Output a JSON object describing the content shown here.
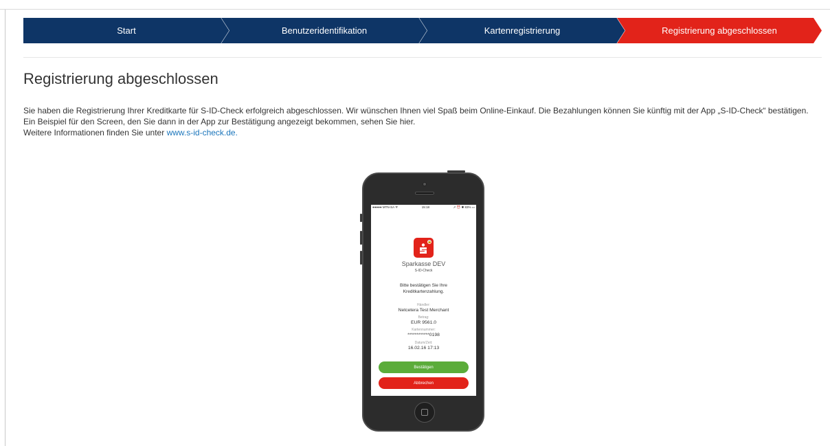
{
  "steps": [
    {
      "label": "Start",
      "state": "done"
    },
    {
      "label": "Benutzeridentifikation",
      "state": "done"
    },
    {
      "label": "Kartenregistrierung",
      "state": "done"
    },
    {
      "label": "Registrierung abgeschlossen",
      "state": "active"
    }
  ],
  "colors": {
    "step_done": "#0e3566",
    "step_active": "#e2231a",
    "link": "#1a75bb",
    "confirm": "#5bac3a",
    "cancel": "#e2231a"
  },
  "page": {
    "title": "Registrierung abgeschlossen",
    "paragraph1": "Sie haben die Registrierung Ihrer Kreditkarte für S-ID-Check erfolgreich abgeschlossen. Wir wünschen Ihnen viel Spaß beim Online-Einkauf. Die Bezahlungen können Sie künftig mit der App „S-ID-Check“ bestätigen. Ein Beispiel für den Screen, den Sie dann in der App zur Bestätigung angezeigt bekommen, sehen Sie hier.",
    "more_info_prefix": "Weitere Informationen finden Sie unter ",
    "more_info_link": "www.s-id-check.de."
  },
  "phone": {
    "status_left": "●●●●● MTN-SA ᯤ",
    "status_time": "15:18",
    "status_right": "➚ ⏰ ✱ 83% ▭",
    "bank_name": "Sparkasse DEV",
    "app_name": "S-ID-Check",
    "prompt_line1": "Bitte bestätigen Sie Ihre",
    "prompt_line2": "Kreditkartenzahlung.",
    "merchant_label": "Händler:",
    "merchant_value": "Netcetera Test Merchant",
    "amount_label": "Betrag:",
    "amount_value": "EUR 9561.0",
    "card_label": "Kartennummer:",
    "card_value": "************0198",
    "datetime_label": "Datum/Zeit:",
    "datetime_value": "16.02.16 17:13",
    "confirm_label": "Bestätigen",
    "cancel_label": "Abbrechen"
  }
}
